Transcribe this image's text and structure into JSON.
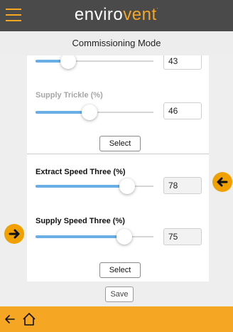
{
  "header": {
    "logo_left": "enviro",
    "logo_right": "vent",
    "logo_mark": ".",
    "menu_icon": "hamburger-menu-icon"
  },
  "mode_title": "Commissioning Mode",
  "settings": [
    {
      "label": "",
      "value": "43",
      "level_pct": 28,
      "enabled": true
    },
    {
      "label": "Supply Trickle (%)",
      "value": "46",
      "level_pct": 46,
      "enabled": false
    },
    {
      "label": "Extract Speed Three (%)",
      "value": "78",
      "level_pct": 78,
      "enabled": true
    },
    {
      "label": "Supply Speed Three (%)",
      "value": "75",
      "level_pct": 75,
      "enabled": true
    }
  ],
  "buttons": {
    "select_1": "Select",
    "select_2": "Select",
    "save": "Save"
  },
  "footer": {
    "back_icon": "back-arrow-icon",
    "home_icon": "home-icon"
  },
  "colors": {
    "accent": "#f5a623",
    "header_bg": "#4a4a4a",
    "slider_fill": "#6aaee6",
    "annotation_arrow": "#f0a100"
  }
}
